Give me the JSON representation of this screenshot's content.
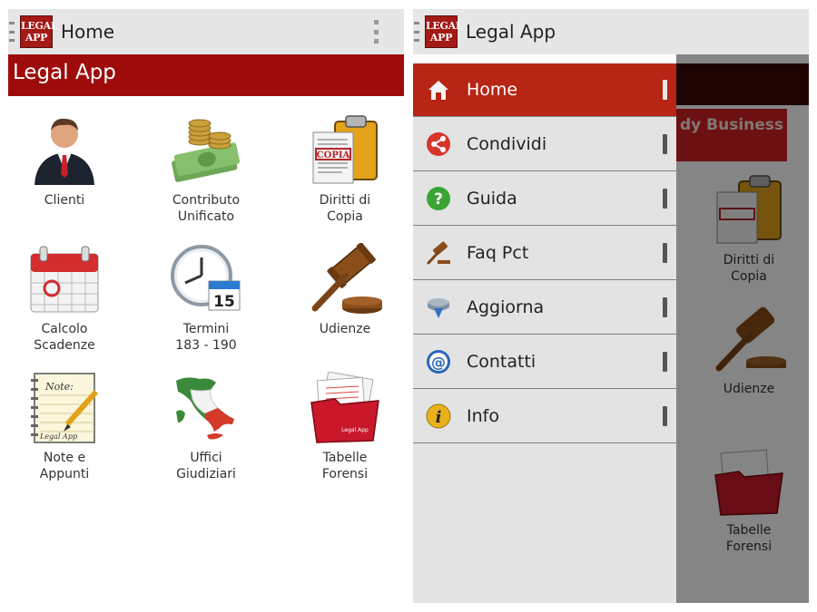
{
  "left_screen": {
    "actionbar_title": "Home",
    "logo_line1": "LEGAL",
    "logo_line2": "APP",
    "banner_title": "Legal App",
    "tiles": [
      {
        "label": "Clienti",
        "icon": "businessman-icon"
      },
      {
        "label": "Contributo\nUnificato",
        "icon": "coin-stack-icon"
      },
      {
        "label": "Diritti di\nCopia",
        "icon": "clipboard-copia-icon"
      },
      {
        "label": "Calcolo\nScadenze",
        "icon": "calendar-icon"
      },
      {
        "label": "Termini\n183 - 190",
        "icon": "clock-calendar-icon"
      },
      {
        "label": "Udienze",
        "icon": "gavel-icon"
      },
      {
        "label": "Note e\nAppunti",
        "icon": "notepad-pen-icon"
      },
      {
        "label": "Uffici\nGiudiziari",
        "icon": "italy-map-icon"
      },
      {
        "label": "Tabelle\nForensi",
        "icon": "red-folder-icon"
      }
    ],
    "note_text": "Note:",
    "note_footer": "Legal App",
    "copia_text": "COPIA",
    "calendar_day": "15",
    "folder_text": "Legal App"
  },
  "right_screen": {
    "actionbar_title": "Legal App",
    "logo_line1": "LEGAL",
    "logo_line2": "APP",
    "menu": [
      {
        "label": "Home",
        "icon": "home-icon"
      },
      {
        "label": "Condividi",
        "icon": "share-icon"
      },
      {
        "label": "Guida",
        "icon": "help-icon"
      },
      {
        "label": "Faq Pct",
        "icon": "gavel-small-icon"
      },
      {
        "label": "Aggiorna",
        "icon": "update-icon"
      },
      {
        "label": "Contatti",
        "icon": "at-icon"
      },
      {
        "label": "Info",
        "icon": "info-icon"
      }
    ],
    "background_business": "dy Business",
    "background_tiles": [
      "Diritti di\nCopia",
      "Udienze",
      "Tabelle\nForensi"
    ]
  },
  "colors": {
    "banner_red": "#9e0b0b",
    "active_red": "#b72514",
    "actionbar_gray": "#e6e6e6",
    "drawer_gray": "#e3e3e3"
  }
}
